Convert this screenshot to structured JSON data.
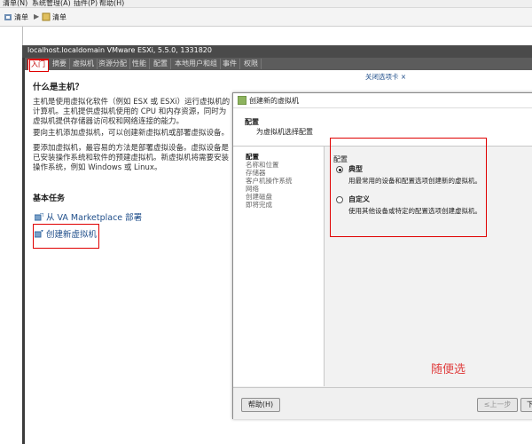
{
  "menubar": {
    "items": [
      "清单(N)",
      "系统管理(A)",
      "插件(P)",
      "帮助(H)"
    ]
  },
  "crumb": {
    "home_label": "清单",
    "current_label": "清单"
  },
  "host": {
    "title": "localhost.localdomain VMware ESXi, 5.5.0, 1331820"
  },
  "tabs": [
    "入门",
    "摘要",
    "虚拟机",
    "资源分配",
    "性能",
    "配置",
    "本地用户和组",
    "事件",
    "权限"
  ],
  "content": {
    "close_tab_link": "关闭选项卡 ×",
    "question": "什么是主机？",
    "para1_lines": [
      "主机是使用虚拟化软件（例如 ESX 或 ESXi）运行虚拟机的",
      "计算机。主机提供虚拟机使用的 CPU 和内存资源，同时为",
      "虚拟机提供存储器访问权和网络连接的能力。"
    ],
    "para2_lines": [
      "要向主机添加虚拟机，可以创建新虚拟机或部署虚拟设备。"
    ],
    "para3_lines": [
      "要添加虚拟机，最容易的方法是部署虚拟设备。虚拟设备是",
      "已安装操作系统和软件的预建虚拟机。新虚拟机将需要安装",
      "操作系统，例如 Windows 或 Linux。"
    ],
    "basic_tasks_title": "基本任务",
    "task_deploy": "从 VA Marketplace 部署",
    "task_create": "创建新虚拟机"
  },
  "dialog": {
    "title": "创建新的虚拟机",
    "header_title": "配置",
    "header_subtitle": "为虚拟机选择配置",
    "nav": [
      "配置",
      "名称和位置",
      "存储器",
      "客户机操作系统",
      "网络",
      "创建磁盘",
      "即将完成"
    ],
    "section_title": "配置",
    "option_typical": {
      "label": "典型",
      "desc": "用最常用的设备和配置选项创建新的虚拟机。",
      "selected": true
    },
    "option_custom": {
      "label": "自定义",
      "desc": "使用其他设备或特定的配置选项创建虚拟机。",
      "selected": false
    },
    "annotation": "随便选",
    "help_button": "帮助(H)",
    "back_button": "≤上一步",
    "next_button": "下"
  },
  "colors": {
    "accent_red": "#e00000",
    "link_blue": "#1f4e8a",
    "annotation_red": "#e04040"
  }
}
